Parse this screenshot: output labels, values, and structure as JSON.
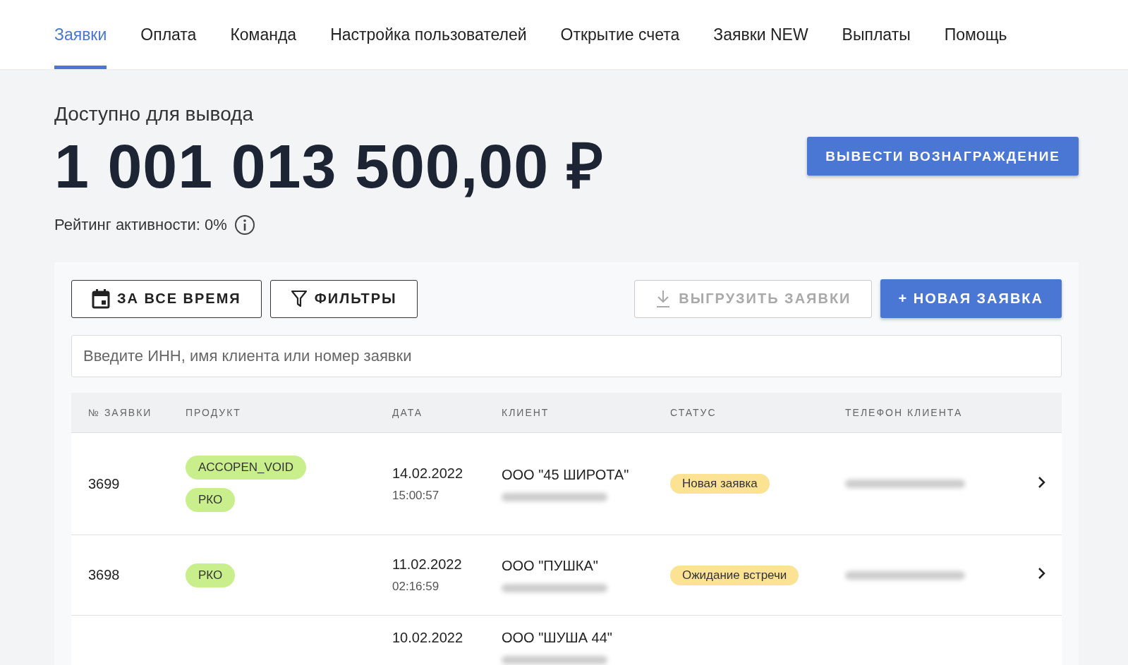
{
  "tabs": [
    {
      "label": "Заявки",
      "selected": true
    },
    {
      "label": "Оплата",
      "selected": false
    },
    {
      "label": "Команда",
      "selected": false
    },
    {
      "label": "Настройка пользователей",
      "selected": false
    },
    {
      "label": "Открытие счета",
      "selected": false
    },
    {
      "label": "Заявки NEW",
      "selected": false
    },
    {
      "label": "Выплаты",
      "selected": false
    },
    {
      "label": "Помощь",
      "selected": false
    }
  ],
  "balance": {
    "label": "Доступно для вывода",
    "amount": "1 001 013 500,00 ₽",
    "rating": "Рейтинг активности: 0%",
    "withdraw_button": "ВЫВЕСТИ ВОЗНАГРАЖДЕНИЕ"
  },
  "toolbar": {
    "period_button": "ЗА ВСЕ ВРЕМЯ",
    "filters_button": "ФИЛЬТРЫ",
    "export_button": {
      "label": "ВЫГРУЗИТЬ ЗАЯВКИ",
      "disabled": true
    },
    "new_button": "+ НОВАЯ ЗАЯВКА"
  },
  "search": {
    "placeholder": "Введите ИНН, имя клиента или номер заявки"
  },
  "table": {
    "columns": [
      "№ ЗАЯВКИ",
      "ПРОДУКТ",
      "ДАТА",
      "КЛИЕНТ",
      "СТАТУС",
      "ТЕЛЕФОН КЛИЕНТА"
    ],
    "rows": [
      {
        "number": "3699",
        "products": [
          "ACCOPEN_VOID",
          "РКО"
        ],
        "date": "14.02.2022",
        "time": "15:00:57",
        "client": "ООО \"45 ШИРОТА\"",
        "status": "Новая заявка"
      },
      {
        "number": "3698",
        "products": [
          "РКО"
        ],
        "date": "11.02.2022",
        "time": "02:16:59",
        "client": "ООО \"ПУШКА\"",
        "status": "Ожидание встречи"
      },
      {
        "date": "10.02.2022",
        "client": "ООО \"ШУША 44\""
      }
    ]
  }
}
